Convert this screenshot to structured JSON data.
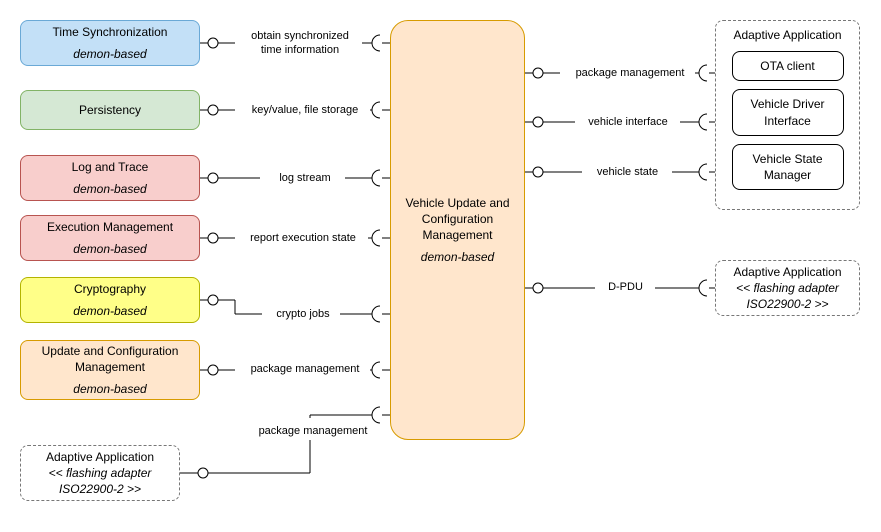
{
  "central": {
    "title": "Vehicle Update and Configuration Management",
    "subtitle": "demon-based"
  },
  "left_nodes": [
    {
      "title": "Time Synchronization",
      "subtitle": "demon-based",
      "bg": "#C3E0F7",
      "border": "#6AA9D6"
    },
    {
      "title": "Persistency",
      "subtitle": "",
      "bg": "#D5E8D4",
      "border": "#82B366"
    },
    {
      "title": "Log and Trace",
      "subtitle": "demon-based",
      "bg": "#F8CECC",
      "border": "#B85450"
    },
    {
      "title": "Execution Management",
      "subtitle": "demon-based",
      "bg": "#F8CECC",
      "border": "#B85450"
    },
    {
      "title": "Cryptography",
      "subtitle": "demon-based",
      "bg": "#FFFF88",
      "border": "#B3B300"
    },
    {
      "title": "Update and Configuration Management",
      "subtitle": "demon-based",
      "bg": "#FFE6CC",
      "border": "#D79B00"
    }
  ],
  "left_adaptive": {
    "title": "Adaptive Application",
    "line1": "<< flashing adapter",
    "line2": "ISO22900-2 >>"
  },
  "right_group": {
    "title": "Adaptive Application",
    "items": [
      "OTA client",
      "Vehicle Driver Interface",
      "Vehicle State Manager"
    ]
  },
  "right_adaptive": {
    "title": "Adaptive Application",
    "line1": "<< flashing adapter",
    "line2": "ISO22900-2 >>"
  },
  "connectors": {
    "c0": "obtain synchronized time information",
    "c1": "key/value, file storage",
    "c2": "log stream",
    "c3": "report execution state",
    "c4": "crypto jobs",
    "c5": "package management",
    "c6": "package management",
    "r0": "package management",
    "r1": "vehicle interface",
    "r2": "vehicle state",
    "r3": "D-PDU"
  }
}
